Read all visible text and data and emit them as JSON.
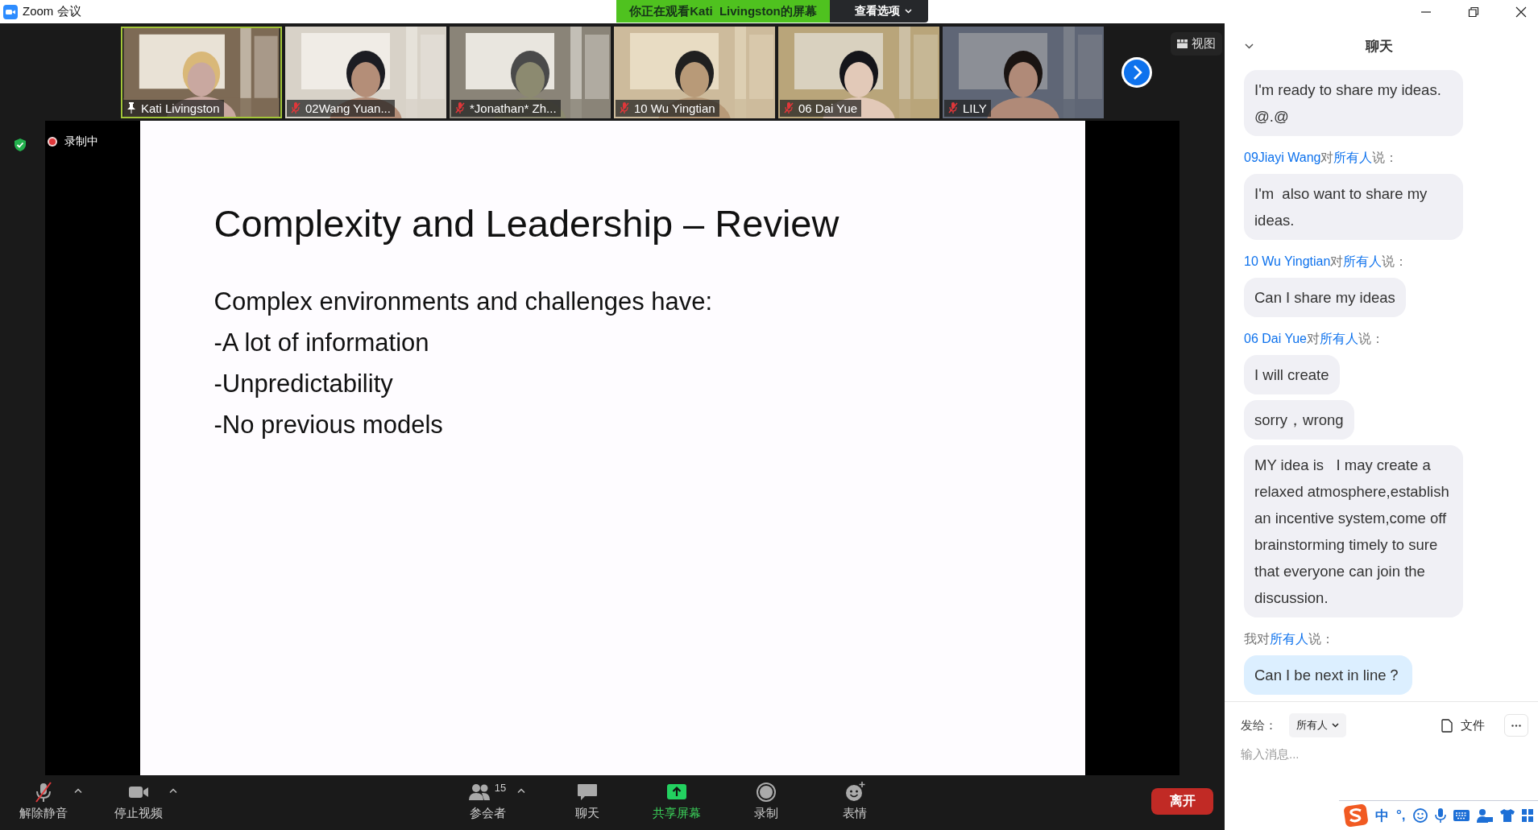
{
  "window": {
    "title": "Zoom 会议"
  },
  "share_banner": {
    "text": "你正在观看Kati  Livingston的屏幕",
    "options_button": "查看选项"
  },
  "view_button": "视图",
  "participants": [
    {
      "name": "Kati Livingston",
      "kind": "pinned",
      "active_speaker": true
    },
    {
      "name": "02Wang Yuan...",
      "kind": "muted",
      "active_speaker": false
    },
    {
      "name": "*Jonathan* Zh...",
      "kind": "muted",
      "active_speaker": false
    },
    {
      "name": "10 Wu Yingtian",
      "kind": "muted",
      "active_speaker": false
    },
    {
      "name": "06 Dai Yue",
      "kind": "muted",
      "active_speaker": false
    },
    {
      "name": "LILY",
      "kind": "muted",
      "active_speaker": false
    }
  ],
  "recording": {
    "label": "录制中"
  },
  "slide": {
    "title": "Complexity and Leadership – Review",
    "lines": [
      "Complex environments and challenges have:",
      "-A lot of information",
      "-Unpredictability",
      "-No previous models"
    ]
  },
  "toolbar": [
    {
      "kind": "mic",
      "label": "解除静音",
      "caret": true
    },
    {
      "kind": "video",
      "label": "停止视频",
      "caret": true
    },
    {
      "kind": "participants",
      "label": "参会者",
      "count": "15",
      "caret": true
    },
    {
      "kind": "chat",
      "label": "聊天",
      "caret": false
    },
    {
      "kind": "share",
      "label": "共享屏幕",
      "caret": false
    },
    {
      "kind": "record",
      "label": "录制",
      "caret": false
    },
    {
      "kind": "reactions",
      "label": "表情",
      "caret": false
    }
  ],
  "leave_button": "离开",
  "chat": {
    "title": "聊天",
    "messages": [
      {
        "kind": "bubble",
        "text": "I'm ready to share my ideas. @.@",
        "own": false
      },
      {
        "kind": "header",
        "sender": "09Jiayi Wang",
        "self": false,
        "connector": "对",
        "recipient": "所有人",
        "suffix": "说："
      },
      {
        "kind": "bubble",
        "text": "I'm  also want to share my ideas.",
        "own": false
      },
      {
        "kind": "header",
        "sender": "10 Wu Yingtian",
        "self": false,
        "connector": "对",
        "recipient": "所有人",
        "suffix": "说："
      },
      {
        "kind": "bubble",
        "text": "Can I share my ideas",
        "own": false
      },
      {
        "kind": "header",
        "sender": "06 Dai Yue",
        "self": false,
        "connector": "对",
        "recipient": "所有人",
        "suffix": "说："
      },
      {
        "kind": "bubble",
        "text": "I will create",
        "own": false
      },
      {
        "kind": "bubble",
        "text": "sorry，wrong",
        "own": false
      },
      {
        "kind": "bubble",
        "text": "MY idea is   I may create a relaxed atmosphere,establish an incentive system,come off brainstorming timely to sure that everyone can join the discussion.",
        "own": false
      },
      {
        "kind": "header",
        "sender": "我",
        "self": true,
        "connector": "对",
        "recipient": "所有人",
        "suffix": "说："
      },
      {
        "kind": "bubble",
        "text": "Can I be next in line？",
        "own": true
      }
    ],
    "send_to_label": "发给：",
    "recipient": "所有人",
    "file_button": "文件",
    "input": {
      "placeholder": "输入消息..."
    }
  },
  "ime": {
    "mode": "中",
    "punctuation": "°,"
  }
}
